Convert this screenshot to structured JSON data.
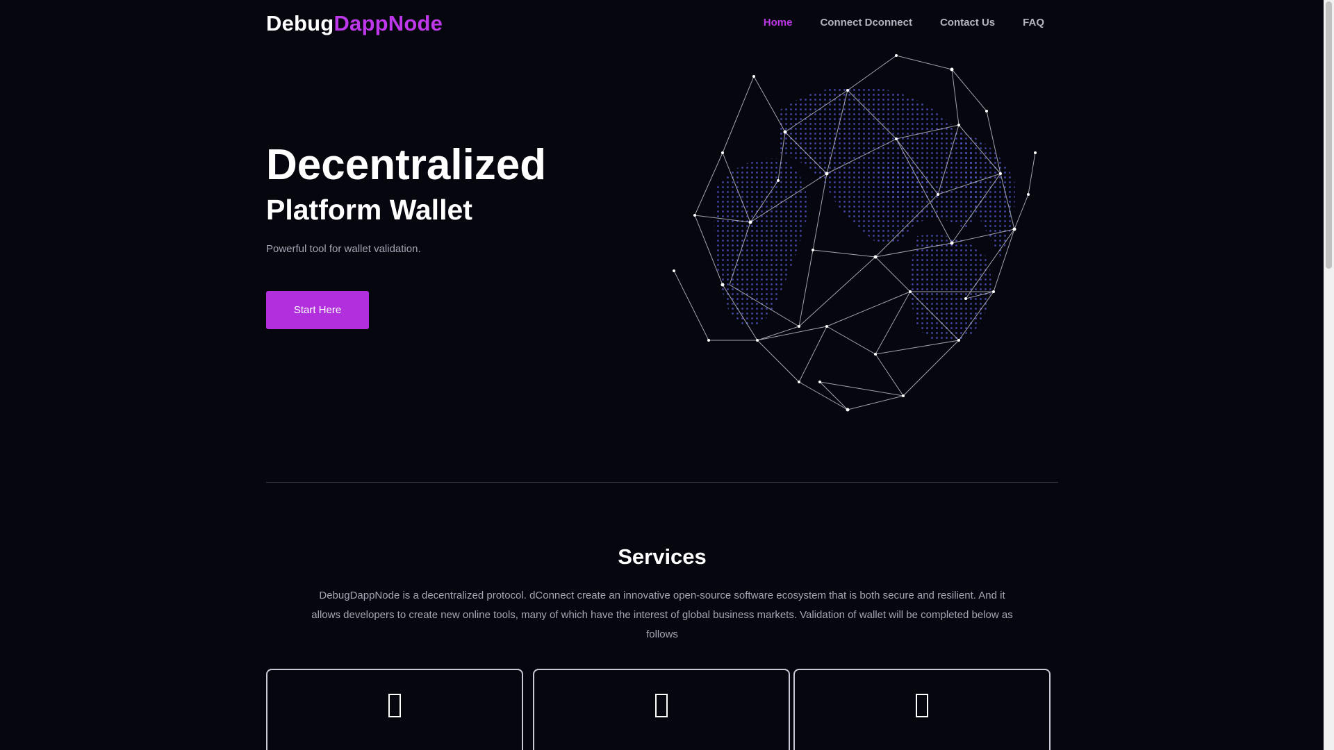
{
  "header": {
    "logo_part1": "Debug",
    "logo_part2": "DappNode",
    "nav": [
      {
        "label": "Home",
        "active": true
      },
      {
        "label": "Connect Dconnect",
        "active": false
      },
      {
        "label": "Contact Us",
        "active": false
      },
      {
        "label": "FAQ",
        "active": false
      }
    ]
  },
  "hero": {
    "title": "Decentralized",
    "subtitle": "Platform Wallet",
    "text": "Powerful tool for wallet validation.",
    "button_label": "Start Here",
    "image_icon": "network-globe-icon"
  },
  "services": {
    "title": "Services",
    "description": "DebugDappNode is a decentralized protocol. dConnect create an innovative open-source software ecosystem that is both secure and resilient. And it allows developers to create new online tools, many of which have the interest of global business markets. Validation of wallet will be completed below as follows",
    "cards": [
      {
        "icon": "service-icon"
      },
      {
        "icon": "service-icon"
      },
      {
        "icon": "service-icon"
      }
    ]
  },
  "colors": {
    "background": "#06060f",
    "accent": "#bd38e8",
    "button": "#b12fdc",
    "muted_text": "#a6a6b4"
  }
}
